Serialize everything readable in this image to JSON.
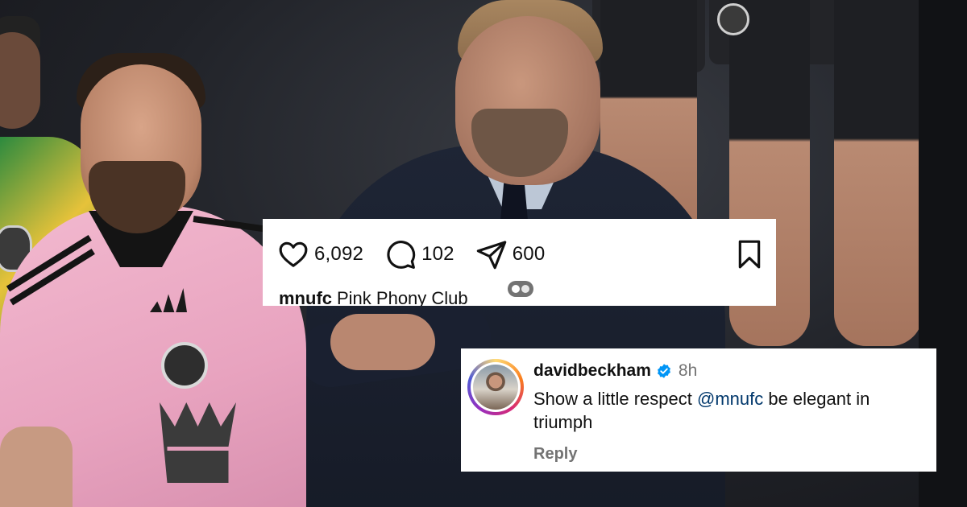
{
  "post": {
    "likes_count": "6,092",
    "comments_count": "102",
    "shares_count": "600",
    "caption_user": "mnufc",
    "caption_text": "Pink Phony Club",
    "icons": {
      "like": "heart-icon",
      "comment": "comment-bubble-icon",
      "share": "paper-plane-icon",
      "save": "bookmark-icon"
    }
  },
  "comment": {
    "username": "davidbeckham",
    "time": "8h",
    "text_before": "Show a little respect ",
    "mention": "@mnufc",
    "text_after": " be elegant in triumph",
    "reply_label": "Reply",
    "verified_color": "#0095f6",
    "mention_color": "#00376b"
  },
  "colors": {
    "card_bg": "#ffffff",
    "text_primary": "#111111",
    "text_secondary": "#737373",
    "jersey_pink": "#f2b9cf"
  }
}
